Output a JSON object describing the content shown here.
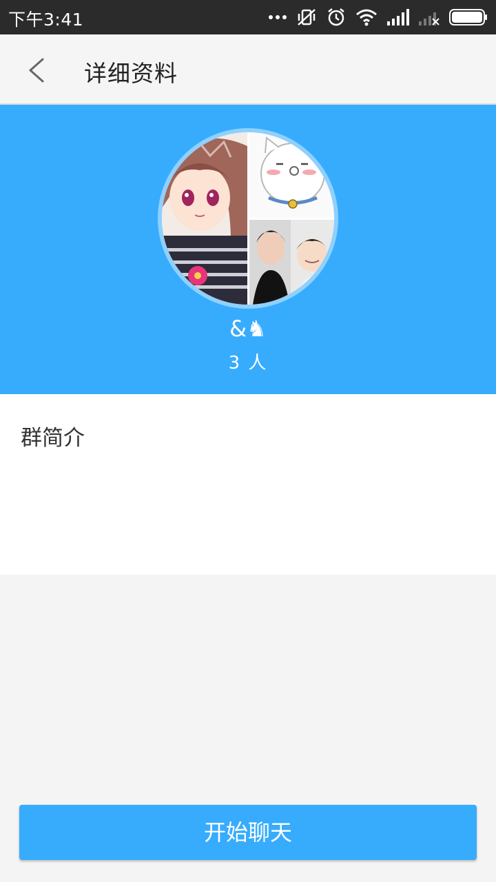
{
  "status_bar": {
    "time": "下午3:41",
    "icons": [
      "more-dots-icon",
      "vibrate-off-icon",
      "alarm-icon",
      "wifi-icon",
      "signal-icon",
      "signal-no-sim-icon",
      "battery-icon"
    ]
  },
  "app_bar": {
    "back_icon": "chevron-left-icon",
    "title": "详细资料"
  },
  "group": {
    "name": "&♞",
    "member_count": "3 人"
  },
  "intro": {
    "label": "群简介"
  },
  "actions": {
    "start_chat_label": "开始聊天"
  },
  "colors": {
    "accent": "#37acfd",
    "status_bar_bg": "#2b2b2b",
    "page_bg": "#f4f4f4"
  }
}
